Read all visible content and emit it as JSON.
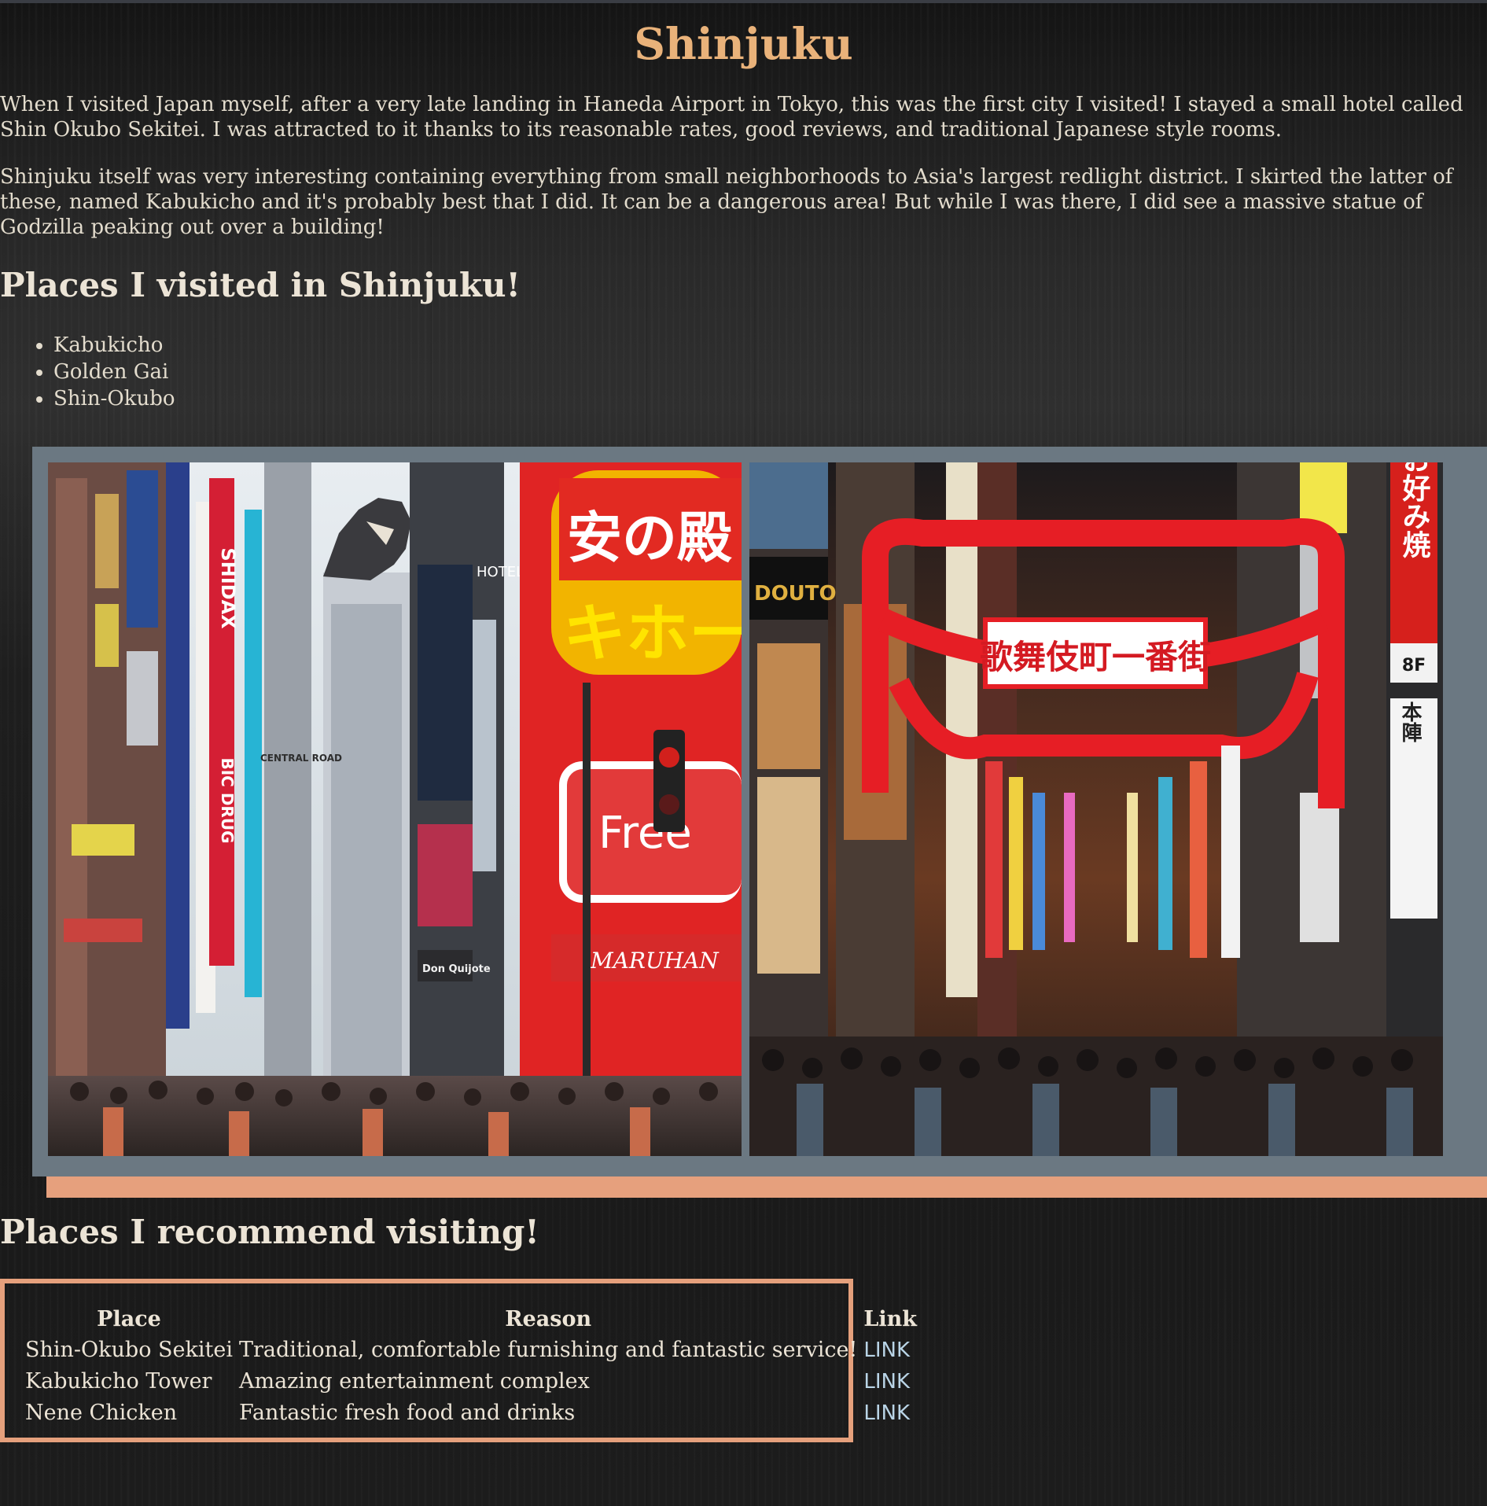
{
  "page": {
    "title": "Shinjuku",
    "paragraphs": [
      "When I visited Japan myself, after a very late landing in Haneda Airport in Tokyo, this was the first city I visited! I stayed a small hotel called Shin Okubo Sekitei. I was attracted to it thanks to its reasonable rates, good reviews, and traditional Japanese style rooms.",
      "Shinjuku itself was very interesting containing everything from small neighborhoods to Asia's largest redlight district. I skirted the latter of these, named Kabukicho and it's probably best that I did. It can be a dangerous area! But while I was there, I did see a massive statue of Godzilla peaking out over a building!"
    ]
  },
  "visited": {
    "heading": "Places I visited in Shinjuku!",
    "items": [
      "Kabukicho",
      "Golden Gai",
      "Shin-Okubo"
    ]
  },
  "gallery": {
    "photo1": {
      "signs": [
        "SHIDAX",
        "BIC DRUG",
        "HOTEL",
        "CENTRAL ROAD",
        "MARUHAN",
        "Don Quijote",
        "Free",
        "安の殿",
        "キホー"
      ]
    },
    "photo2": {
      "signs": [
        "歌舞伎町一番街",
        "お好み焼",
        "本陣",
        "8F",
        "DOUTOR"
      ]
    }
  },
  "recommend": {
    "heading": "Places I recommend visiting!",
    "columns": [
      "Place",
      "Reason",
      "Link"
    ],
    "rows": [
      {
        "place": "Shin-Okubo Sekitei",
        "reason": "Traditional, comfortable furnishing and fantastic service!",
        "link": "LINK"
      },
      {
        "place": "Kabukicho Tower",
        "reason": "Amazing entertainment complex",
        "link": "LINK"
      },
      {
        "place": "Nene Chicken",
        "reason": "Fantastic fresh food and drinks",
        "link": "LINK"
      }
    ]
  },
  "colors": {
    "title": "#e9b27a",
    "accent_border": "#e5a07c",
    "gallery_frame": "#6b7882",
    "link": "#b9d4e6"
  }
}
